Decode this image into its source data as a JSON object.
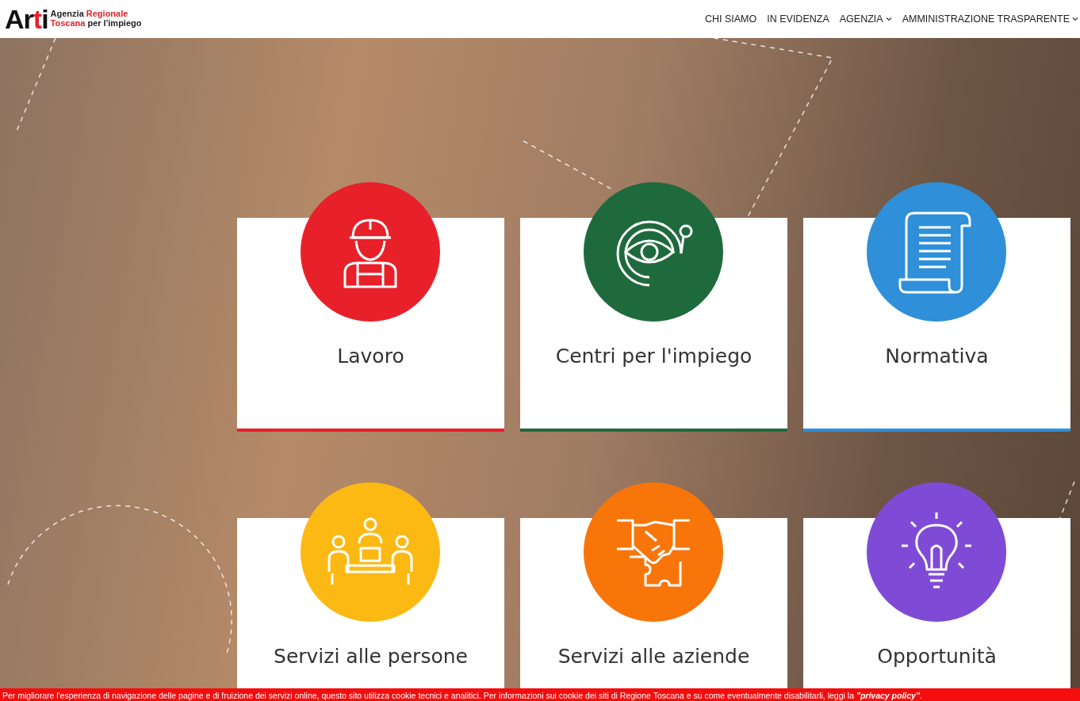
{
  "header": {
    "logo": {
      "parts": [
        {
          "text": "Ar",
          "accent": false
        },
        {
          "text": "t",
          "accent": true
        },
        {
          "text": "i",
          "accent": false
        }
      ]
    },
    "tagline": [
      [
        {
          "text": "Agenzia ",
          "accent": false
        },
        {
          "text": "Regionale",
          "accent": true
        }
      ],
      [
        {
          "text": "Toscana",
          "accent": true
        },
        {
          "text": " per l'impiego",
          "accent": false
        }
      ]
    ],
    "nav": [
      {
        "label": "CHI SIAMO",
        "dropdown": false
      },
      {
        "label": "IN EVIDENZA",
        "dropdown": false
      },
      {
        "label": "AGENZIA",
        "dropdown": true
      },
      {
        "label": "AMMINISTRAZIONE TRASPARENTE",
        "dropdown": true
      }
    ]
  },
  "cards": [
    {
      "title": "Lavoro",
      "kind": "worker",
      "color": "#e8202a"
    },
    {
      "title": "Centri per l'impiego",
      "kind": "eye",
      "color": "#1f6a3d"
    },
    {
      "title": "Normativa",
      "kind": "scroll",
      "color": "#2f8fd8"
    },
    {
      "title": "Servizi alle persone",
      "kind": "meeting",
      "color": "#fdb913"
    },
    {
      "title": "Servizi alle aziende",
      "kind": "handshake",
      "color": "#f8750a"
    },
    {
      "title": "Opportunità",
      "kind": "bulb",
      "color": "#7f4bd6"
    }
  ],
  "cookie_bar": {
    "text": "Per migliorare l'esperienza di navigazione delle pagine e di fruizione dei servizi online, questo sito utilizza cookie tecnici e analitici. Per informazioni sui cookie dei siti di Regione Toscana e su come eventualmente disabilitarli, leggi la ",
    "link": "\"privacy policy\"",
    "end": "."
  }
}
